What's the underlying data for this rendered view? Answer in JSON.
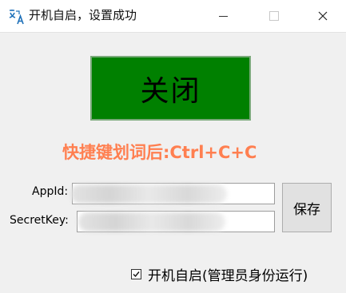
{
  "window": {
    "title": "开机自启，设置成功",
    "app_icon": "translate-icon"
  },
  "titlebar_buttons": {
    "minimize": "minimize-icon",
    "maximize": "maximize-icon",
    "close": "close-icon"
  },
  "main": {
    "toggle_button_label": "关闭",
    "toggle_button_color": "#008000",
    "hint_text": "快捷键划词后:Ctrl+C+C",
    "hint_color": "#ff7f50"
  },
  "form": {
    "appid_label": "AppId:",
    "appid_value": "",
    "secretkey_label": "SecretKey:",
    "secretkey_value": "",
    "save_label": "保存"
  },
  "options": {
    "autostart_label": "开机自启(管理员身份运行)",
    "autostart_checked": true
  }
}
